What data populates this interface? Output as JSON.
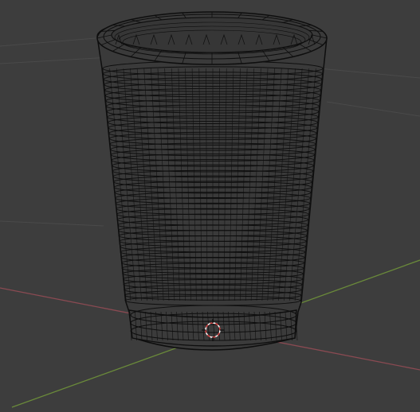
{
  "viewport": {
    "mode": "wireframe",
    "background_color": "#3d3d3d",
    "grid_color": "#4a4a4a",
    "x_axis_color": "#8a4a52",
    "y_axis_color": "#6a8a3a",
    "wire_color": "#0e0e0e",
    "object_fill": "#3a3a3a",
    "cursor_color": "#d84040"
  },
  "object": {
    "shape": "cup",
    "ring_count": 44,
    "meridian_count": 32
  }
}
